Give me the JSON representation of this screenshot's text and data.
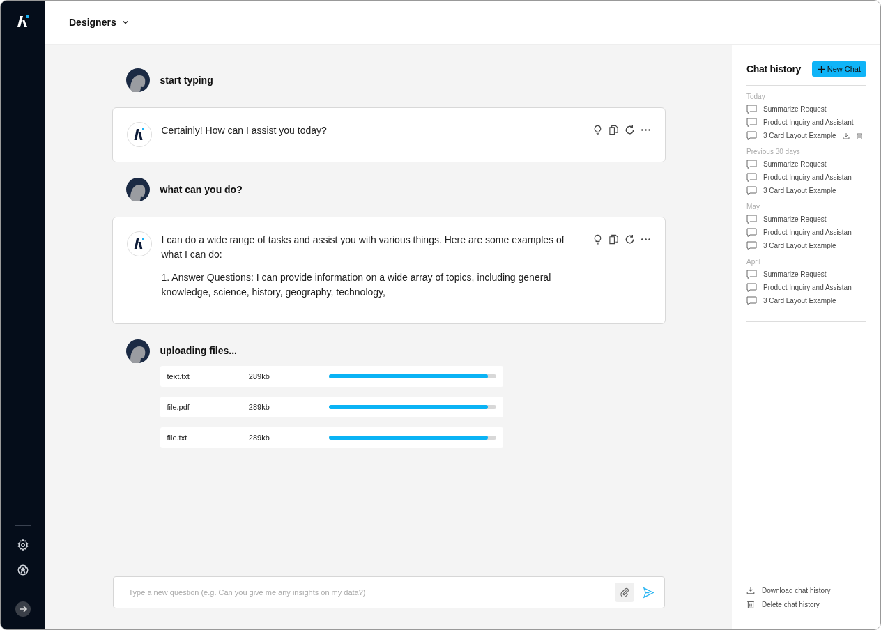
{
  "header": {
    "workspace": "Designers"
  },
  "messages": [
    {
      "kind": "user",
      "text": "start typing"
    },
    {
      "kind": "assistant",
      "paragraphs": [
        "Certainly! How can I assist you today?"
      ]
    },
    {
      "kind": "user",
      "text": "what can you do?"
    },
    {
      "kind": "assistant",
      "paragraphs": [
        "I can do a wide range of tasks and assist you with various things. Here are some examples of what I can do:",
        "1. Answer Questions: I can provide information on a wide array of topics, including general knowledge, science, history, geography, technology,"
      ]
    },
    {
      "kind": "upload",
      "text": "uploading files...",
      "files": [
        {
          "name": "text.txt",
          "size": "289kb",
          "level": 0.95
        },
        {
          "name": "file.pdf",
          "size": "289kb",
          "level": 0.95
        },
        {
          "name": "file.txt",
          "size": "289kb",
          "level": 0.95
        }
      ]
    }
  ],
  "composer": {
    "placeholder": "Type a new question (e.g. Can you give me any insights on my data?)"
  },
  "history": {
    "title": "Chat history",
    "new_chat": "New Chat",
    "groups": [
      {
        "label": "Today",
        "items": [
          {
            "title": "Summarize Request",
            "hovered": false
          },
          {
            "title": "Product Inquiry and Assistant",
            "hovered": false
          },
          {
            "title": "3 Card Layout Example",
            "hovered": true
          }
        ]
      },
      {
        "label": "Previous 30 days",
        "items": [
          {
            "title": "Summarize Request",
            "hovered": false
          },
          {
            "title": "Product Inquiry and Assistan",
            "hovered": false
          },
          {
            "title": "3 Card Layout Example",
            "hovered": false
          }
        ]
      },
      {
        "label": "May",
        "items": [
          {
            "title": "Summarize Request",
            "hovered": false
          },
          {
            "title": "Product Inquiry and Assistan",
            "hovered": false
          },
          {
            "title": "3 Card Layout Example",
            "hovered": false
          }
        ]
      },
      {
        "label": "April",
        "items": [
          {
            "title": "Summarize Request",
            "hovered": false
          },
          {
            "title": "Product Inquiry and Assistan",
            "hovered": false
          },
          {
            "title": "3 Card Layout Example",
            "hovered": false
          }
        ]
      }
    ],
    "download": "Download chat history",
    "delete": "Delete chat history"
  }
}
